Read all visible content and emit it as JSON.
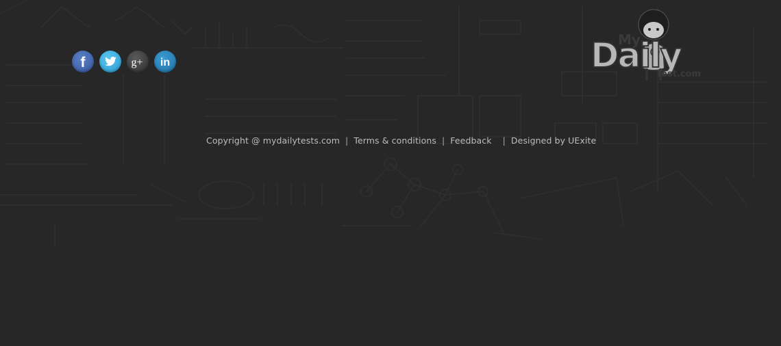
{
  "social": [
    {
      "name": "facebook",
      "glyph": "f",
      "icon": "facebook-icon"
    },
    {
      "name": "twitter",
      "glyph": "",
      "icon": "twitter-icon"
    },
    {
      "name": "google-plus",
      "glyph": "g+",
      "icon": "google-plus-icon"
    },
    {
      "name": "linkedin",
      "glyph": "in",
      "icon": "linkedin-icon"
    }
  ],
  "footer": {
    "copyright": "Copyright @ mydailytests.com",
    "terms": "Terms & conditions",
    "feedback": "Feedback",
    "designed_by": "Designed by UExite",
    "separator": "|"
  },
  "logo": {
    "my": "My",
    "daily": "Daily",
    "sub": "Test.com"
  },
  "colors": {
    "background": "#272727",
    "link_text": "#bdbdbd",
    "facebook": "#3b5998",
    "twitter": "#2a9bd2",
    "google_plus": "#333333",
    "linkedin": "#1f70a6"
  }
}
